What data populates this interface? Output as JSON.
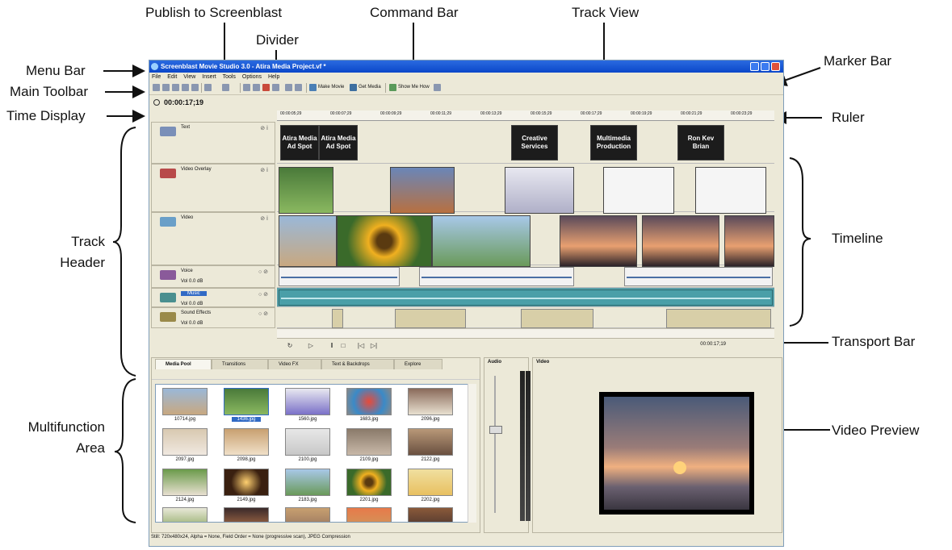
{
  "callouts": {
    "publish": "Publish to Screenblast",
    "command_bar": "Command Bar",
    "track_view": "Track View",
    "divider": "Divider",
    "menu_bar": "Menu Bar",
    "main_toolbar": "Main Toolbar",
    "time_display": "Time Display",
    "marker_bar": "Marker Bar",
    "ruler": "Ruler",
    "track_header_1": "Track",
    "track_header_2": "Header",
    "timeline": "Timeline",
    "transport_bar": "Transport Bar",
    "multifunction_1": "Multifunction",
    "multifunction_2": "Area",
    "video_preview": "Video Preview"
  },
  "app": {
    "title": "Screenblast Movie Studio 3.0 - Atira Media Project.vf *",
    "menu": [
      "File",
      "Edit",
      "View",
      "Insert",
      "Tools",
      "Options",
      "Help"
    ],
    "toolbar": {
      "make_movie": "Make Movie",
      "get_media": "Get Media",
      "show_me_how": "Show Me How"
    },
    "time_display": "00:00:17;19",
    "ruler_ticks": [
      "00:00:05;29",
      "00:00:07;29",
      "00:00:09;29",
      "00:00:11;29",
      "00:00:13;29",
      "00:00:15;29",
      "00:00:17;29",
      "00:00:19;29",
      "00:00:21;29",
      "00:00:23;29"
    ],
    "tracks": {
      "text": {
        "name": "Text"
      },
      "video_overlay": {
        "name": "Video Overlay"
      },
      "video": {
        "name": "Video"
      },
      "voice": {
        "name": "Voice",
        "vol": "Vol 0.0 dB"
      },
      "music": {
        "name": "Music",
        "vol": "Vol 0.0 dB"
      },
      "sound_effects": {
        "name": "Sound Effects",
        "vol": "Vol 0.0 dB"
      }
    },
    "text_clips": [
      "Atira Media Ad Spot",
      "Atira Media Ad Spot",
      "Creative Services",
      "Multimedia Production",
      "Ron Kev Brian"
    ],
    "transport_time": "00:00:17;19",
    "tabs": [
      "Media Pool",
      "Transitions",
      "Video FX",
      "Text & Backdrops",
      "Explore"
    ],
    "media_files": [
      "10714.jpg",
      "1436.jpg",
      "1560.jpg",
      "1683.jpg",
      "2096.jpg",
      "2097.jpg",
      "2098.jpg",
      "2100.jpg",
      "2109.jpg",
      "2122.jpg",
      "2124.jpg",
      "2149.jpg",
      "2183.jpg",
      "2201.jpg",
      "2202.jpg"
    ],
    "status": "Still: 720x480x24, Alpha = None, Field Order = None (progressive scan), JPEG Compression",
    "audio_label": "Audio",
    "video_label": "Video"
  }
}
